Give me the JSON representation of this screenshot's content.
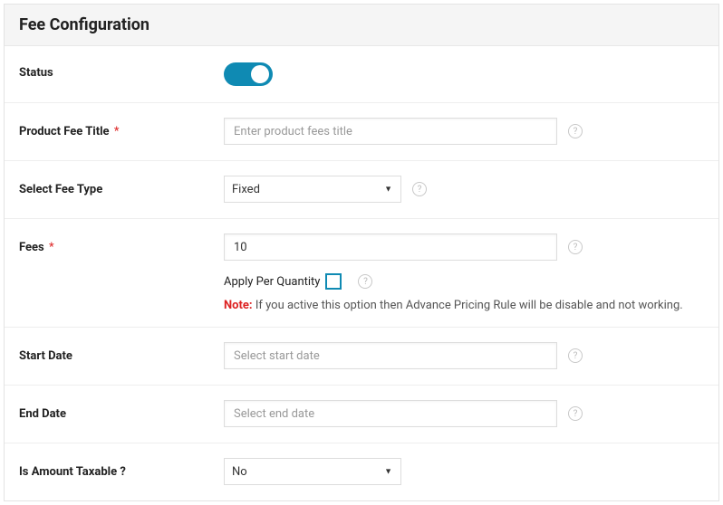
{
  "header": {
    "title": "Fee Configuration"
  },
  "rows": {
    "status": {
      "label": "Status"
    },
    "product_fee_title": {
      "label": "Product Fee Title",
      "required": "*",
      "placeholder": "Enter product fees title",
      "value": ""
    },
    "fee_type": {
      "label": "Select Fee Type",
      "selected": "Fixed"
    },
    "fees": {
      "label": "Fees",
      "required": "*",
      "value": "10",
      "apq_label": "Apply Per Quantity",
      "note_label": "Note:",
      "note_text": " If you active this option then Advance Pricing Rule will be disable and not working."
    },
    "start_date": {
      "label": "Start Date",
      "placeholder": "Select start date",
      "value": ""
    },
    "end_date": {
      "label": "End Date",
      "placeholder": "Select end date",
      "value": ""
    },
    "taxable": {
      "label": "Is Amount Taxable ?",
      "selected": "No"
    }
  }
}
